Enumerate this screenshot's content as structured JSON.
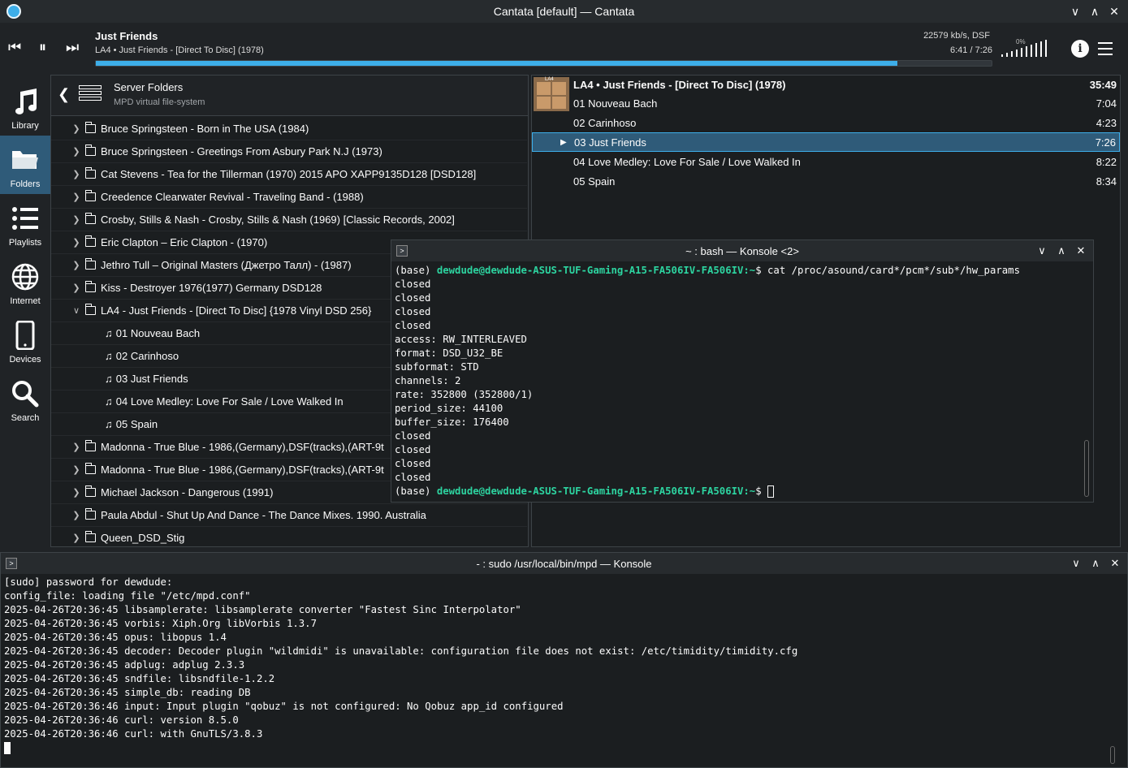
{
  "window": {
    "title": "Cantata [default] — Cantata"
  },
  "player": {
    "title": "Just Friends",
    "subtitle": "LA4 • Just Friends - [Direct To Disc] (1978)",
    "progress_fraction": 0.895,
    "bitrate": "22579 kb/s, DSF",
    "time": "6:41 / 7:26",
    "volume": "0%"
  },
  "sidebar": {
    "items": [
      {
        "label": "Library",
        "icon": "music-note-icon"
      },
      {
        "label": "Folders",
        "icon": "folder-icon"
      },
      {
        "label": "Playlists",
        "icon": "list-icon"
      },
      {
        "label": "Internet",
        "icon": "globe-icon"
      },
      {
        "label": "Devices",
        "icon": "phone-icon"
      },
      {
        "label": "Search",
        "icon": "search-icon"
      }
    ]
  },
  "folders": {
    "title": "Server Folders",
    "subtitle": "MPD virtual file-system",
    "rows": [
      {
        "text": "Bruce Springsteen - Born in The USA (1984)"
      },
      {
        "text": "Bruce Springsteen - Greetings From Asbury Park N.J (1973)"
      },
      {
        "text": "Cat Stevens - Tea for the Tillerman (1970) 2015 APO XAPP9135D128 [DSD128]"
      },
      {
        "text": "Creedence Clearwater Revival - Traveling Band - (1988)"
      },
      {
        "text": "Crosby, Stills & Nash - Crosby, Stills & Nash (1969)  [Classic Records, 2002]"
      },
      {
        "text": "Eric Clapton – Eric Clapton - (1970)"
      },
      {
        "text": "Jethro Tull – Original Masters (Джетро Талл) - (1987)"
      },
      {
        "text": "Kiss - Destroyer 1976(1977) Germany DSD128"
      },
      {
        "text": "LA4 - Just Friends - [Direct To Disc] {1978 Vinyl DSD 256}"
      },
      {
        "text": "01 Nouveau Bach"
      },
      {
        "text": "02 Carinhoso"
      },
      {
        "text": "03 Just Friends"
      },
      {
        "text": "04 Love Medley: Love For Sale / Love Walked In"
      },
      {
        "text": "05 Spain"
      },
      {
        "text": "Madonna - True Blue - 1986,(Germany),DSF(tracks),(ART-9t"
      },
      {
        "text": "Madonna - True Blue - 1986,(Germany),DSF(tracks),(ART-9t"
      },
      {
        "text": "Michael Jackson - Dangerous (1991)"
      },
      {
        "text": "Paula Abdul - Shut Up And Dance - The Dance Mixes. 1990. Australia"
      },
      {
        "text": "Queen_DSD_Stig"
      }
    ]
  },
  "playqueue": {
    "album": "LA4 • Just Friends - [Direct To Disc] (1978)",
    "total": "35:49",
    "cover_label": "LA4",
    "tracks": [
      {
        "name": "01 Nouveau Bach",
        "dur": "7:04"
      },
      {
        "name": "02 Carinhoso",
        "dur": "4:23"
      },
      {
        "name": "03 Just Friends",
        "dur": "7:26"
      },
      {
        "name": "04 Love Medley: Love For Sale / Love Walked In",
        "dur": "8:22"
      },
      {
        "name": "05 Spain",
        "dur": "8:34"
      }
    ]
  },
  "konsole1": {
    "title": "~ : bash — Konsole <2>",
    "prompt_prefix": "(base) ",
    "prompt_user": "dewdude@dewdude-ASUS-TUF-Gaming-A15-FA506IV-FA506IV:~",
    "prompt_suffix": "$ ",
    "command": "cat /proc/asound/card*/pcm*/sub*/hw_params",
    "lines": [
      "closed",
      "closed",
      "closed",
      "closed",
      "access: RW_INTERLEAVED",
      "format: DSD_U32_BE",
      "subformat: STD",
      "channels: 2",
      "rate: 352800 (352800/1)",
      "period_size: 44100",
      "buffer_size: 176400",
      "closed",
      "closed",
      "closed",
      "closed"
    ]
  },
  "konsole2": {
    "title": "- : sudo /usr/local/bin/mpd — Konsole",
    "lines": [
      "[sudo] password for dewdude:",
      "config_file: loading file \"/etc/mpd.conf\"",
      "2025-04-26T20:36:45 libsamplerate: libsamplerate converter \"Fastest Sinc Interpolator\"",
      "2025-04-26T20:36:45 vorbis: Xiph.Org libVorbis 1.3.7",
      "2025-04-26T20:36:45 opus: libopus 1.4",
      "2025-04-26T20:36:45 decoder: Decoder plugin \"wildmidi\" is unavailable: configuration file does not exist: /etc/timidity/timidity.cfg",
      "2025-04-26T20:36:45 adplug: adplug 2.3.3",
      "2025-04-26T20:36:45 sndfile: libsndfile-1.2.2",
      "2025-04-26T20:36:45 simple_db: reading DB",
      "2025-04-26T20:36:46 input: Input plugin \"qobuz\" is not configured: No Qobuz app_id configured",
      "2025-04-26T20:36:46 curl: version 8.5.0",
      "2025-04-26T20:36:46 curl: with GnuTLS/3.8.3"
    ]
  }
}
